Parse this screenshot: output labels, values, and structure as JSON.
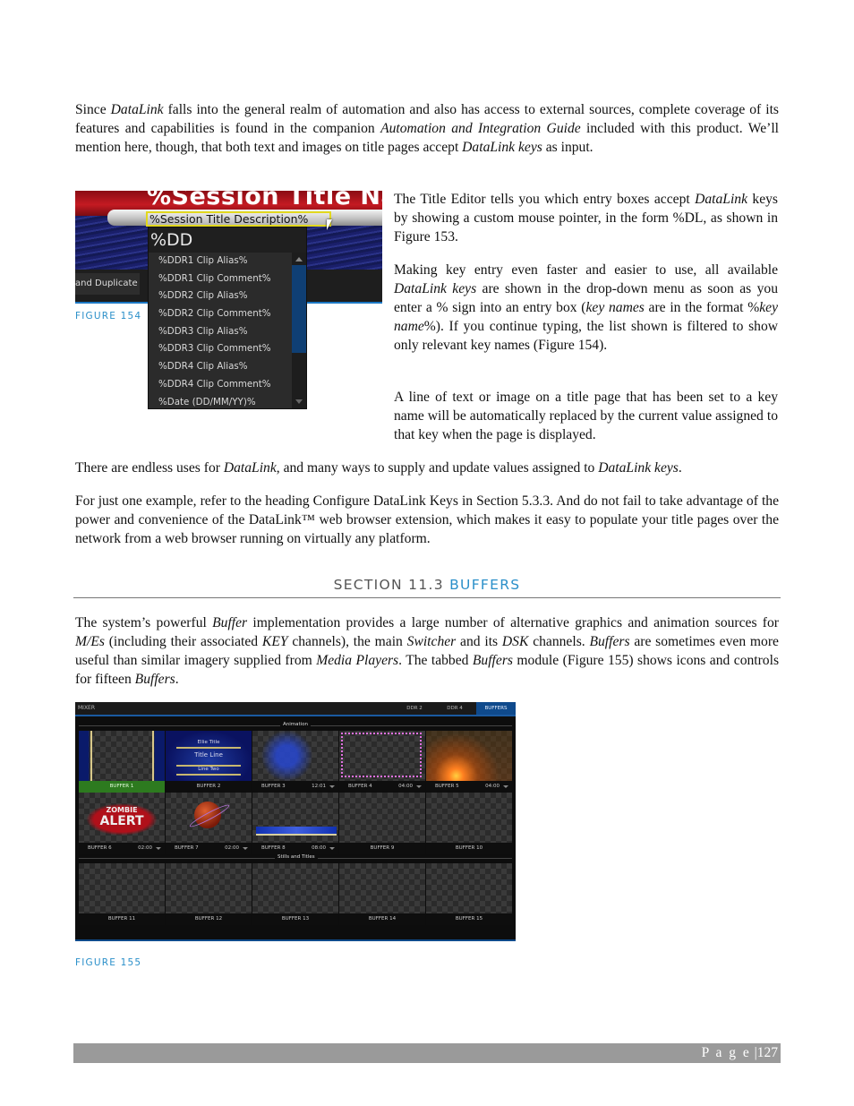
{
  "paragraphs": {
    "p1": [
      {
        "t": "Since "
      },
      {
        "t": "DataLink",
        "i": true
      },
      {
        "t": " falls into the general realm of automation and also has access to external sources, complete coverage of its features and capabilities is found in the companion "
      },
      {
        "t": "Automation and Integration Guide",
        "i": true
      },
      {
        "t": " included with this product.  We’ll mention here, though, that both text and images on title pages accept "
      },
      {
        "t": "DataLink keys",
        "i": true
      },
      {
        "t": " as input."
      }
    ],
    "p2": [
      {
        "t": "The Title Editor tells you which entry boxes accept "
      },
      {
        "t": "DataLink",
        "i": true
      },
      {
        "t": " keys by showing a custom mouse pointer, in the form %DL, as shown in Figure 153."
      }
    ],
    "p3": [
      {
        "t": "Making key entry even faster and easier to use, all available "
      },
      {
        "t": "DataLink keys",
        "i": true
      },
      {
        "t": " are shown in the drop-down menu as soon as you enter a % sign into an entry box ("
      },
      {
        "t": "key names",
        "i": true
      },
      {
        "t": " are in the format %"
      },
      {
        "t": "key name",
        "i": true
      },
      {
        "t": "%).  If you continue typing, the list shown is filtered to show only relevant key names (Figure 154)."
      }
    ],
    "p4": [
      {
        "t": "A line of text or image on a title page that has been set to a key name will be automatically replaced by the current value assigned to that key when the page is displayed."
      }
    ],
    "p5": [
      {
        "t": "There are endless uses for "
      },
      {
        "t": "DataLink",
        "i": true
      },
      {
        "t": ", and many ways to supply and update values assigned to "
      },
      {
        "t": "DataLink keys",
        "i": true
      },
      {
        "t": "."
      }
    ],
    "p6": [
      {
        "t": "For just one example, refer to the heading Configure DataLink Keys in Section 5.3.3.  And do not fail to take advantage of the power and convenience of the DataLink™ web browser extension, which makes it easy to populate your title pages over the network from a web browser running on virtually any platform."
      }
    ],
    "p7": [
      {
        "t": "The system’s powerful "
      },
      {
        "t": "Buffer",
        "i": true
      },
      {
        "t": " implementation provides a large number of alternative graphics and animation sources for "
      },
      {
        "t": "M/Es",
        "i": true
      },
      {
        "t": " (including their associated "
      },
      {
        "t": "KEY",
        "i": true
      },
      {
        "t": " channels), the main "
      },
      {
        "t": "Switcher",
        "i": true
      },
      {
        "t": " and its "
      },
      {
        "t": "DSK",
        "i": true
      },
      {
        "t": " channels.  "
      },
      {
        "t": "Buffers",
        "i": true
      },
      {
        "t": " are sometimes even more useful than similar imagery supplied from "
      },
      {
        "t": "Media Players",
        "i": true
      },
      {
        "t": ". The tabbed "
      },
      {
        "t": "Buffers",
        "i": true
      },
      {
        "t": " module (Figure 155) shows icons and controls for fifteen "
      },
      {
        "t": "Buffers",
        "i": true
      },
      {
        "t": "."
      }
    ]
  },
  "figure154": {
    "caption": "FIGURE 154",
    "title_text": "%Session Title Nar",
    "entry_value": "%Session Title Description%",
    "toolbar_button": "and Duplicate",
    "dropdown_filter": "%DD",
    "dropdown_items": [
      "%DDR1 Clip Alias%",
      "%DDR1 Clip Comment%",
      "%DDR2 Clip Alias%",
      "%DDR2 Clip Comment%",
      "%DDR3 Clip Alias%",
      "%DDR3 Clip Comment%",
      "%DDR4 Clip Alias%",
      "%DDR4 Clip Comment%",
      "%Date (DD/MM/YY)%"
    ]
  },
  "section": {
    "prefix": "SECTION 11.3",
    "title": "BUFFERS"
  },
  "figure155": {
    "caption": "FIGURE 155",
    "header_label": "MIXER",
    "tabs": [
      {
        "label": "DDR 2",
        "active": false
      },
      {
        "label": "DDR 4",
        "active": false
      },
      {
        "label": "BUFFERS",
        "active": true
      }
    ],
    "groups": {
      "animation": "Animation",
      "stills": "Stills and Titles"
    },
    "thumb_text": {
      "b2_top": "Ellie Title",
      "b2_main": "Title Line",
      "b2_bottom": "Line Two",
      "b6_line1": "ZOMBIE",
      "b6_line2": "ALERT"
    },
    "buffers": [
      {
        "name": "BUFFER 1",
        "time": "",
        "selected": true
      },
      {
        "name": "BUFFER 2",
        "time": "",
        "selected": false
      },
      {
        "name": "BUFFER 3",
        "time": "12:01",
        "selected": false
      },
      {
        "name": "BUFFER 4",
        "time": "04:00",
        "selected": false
      },
      {
        "name": "BUFFER 5",
        "time": "04:00",
        "selected": false
      },
      {
        "name": "BUFFER 6",
        "time": "02:00",
        "selected": false
      },
      {
        "name": "BUFFER 7",
        "time": "02:00",
        "selected": false
      },
      {
        "name": "BUFFER 8",
        "time": "08:00",
        "selected": false
      },
      {
        "name": "BUFFER 9",
        "time": "",
        "selected": false
      },
      {
        "name": "BUFFER 10",
        "time": "",
        "selected": false
      },
      {
        "name": "BUFFER 11",
        "time": "",
        "selected": false
      },
      {
        "name": "BUFFER 12",
        "time": "",
        "selected": false
      },
      {
        "name": "BUFFER 13",
        "time": "",
        "selected": false
      },
      {
        "name": "BUFFER 14",
        "time": "",
        "selected": false
      },
      {
        "name": "BUFFER 15",
        "time": "",
        "selected": false
      }
    ]
  },
  "footer": {
    "page_label": "P a g e",
    "separator": "|",
    "page_number": "127"
  },
  "colors": {
    "accent": "#2a8fc9",
    "footer_bar": "#9a9a9a",
    "selected_buffer": "#2d7a1f",
    "active_tab": "#0f4a8c"
  }
}
